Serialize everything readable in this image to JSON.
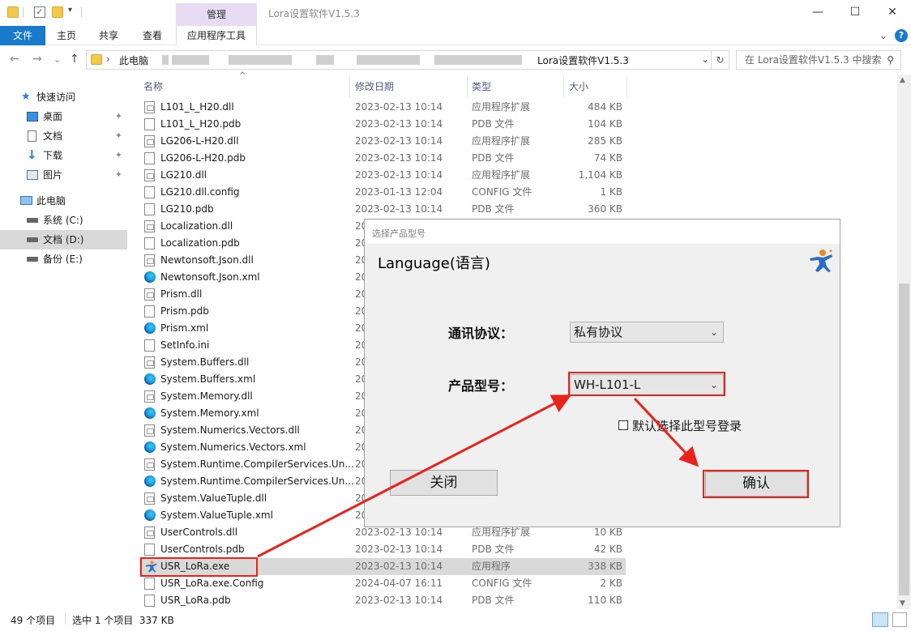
{
  "window": {
    "title": "Lora设置软件V1.5.3",
    "context_tab": "管理",
    "minimize": "—",
    "maximize": "☐",
    "close": "✕"
  },
  "ribbon": {
    "tabs": [
      "文件",
      "主页",
      "共享",
      "查看",
      "应用程序工具"
    ],
    "collapse_glyph": "⌄",
    "help_glyph": "?"
  },
  "address": {
    "back": "←",
    "forward": "→",
    "recent": "⌄",
    "up": "↑",
    "root": "此电脑",
    "current": "Lora设置软件V1.5.3",
    "sep": "›",
    "dropdown": "⌄",
    "refresh": "↻",
    "search_placeholder": "在 Lora设置软件V1.5.3 中搜索",
    "search_icon": "⚲"
  },
  "sidebar": {
    "quick_access": "快速访问",
    "quick_items": [
      {
        "label": "桌面",
        "icon": "desktop-icon"
      },
      {
        "label": "文档",
        "icon": "document-icon"
      },
      {
        "label": "下载",
        "icon": "download-icon"
      },
      {
        "label": "图片",
        "icon": "pictures-icon"
      }
    ],
    "pin_glyph": "📌",
    "this_pc": "此电脑",
    "drives": [
      {
        "label": "系统 (C:)"
      },
      {
        "label": "文档 (D:)"
      },
      {
        "label": "备份 (E:)"
      }
    ]
  },
  "columns": {
    "name": "名称",
    "date": "修改日期",
    "type": "类型",
    "size": "大小",
    "sort_glyph": "^"
  },
  "files": [
    {
      "name": "L101_L_H20.dll",
      "date": "2023-02-13 10:14",
      "type": "应用程序扩展",
      "size": "484 KB",
      "icon": "dll"
    },
    {
      "name": "L101_L_H20.pdb",
      "date": "2023-02-13 10:14",
      "type": "PDB 文件",
      "size": "104 KB",
      "icon": "doc"
    },
    {
      "name": "LG206-L-H20.dll",
      "date": "2023-02-13 10:14",
      "type": "应用程序扩展",
      "size": "285 KB",
      "icon": "dll"
    },
    {
      "name": "LG206-L-H20.pdb",
      "date": "2023-02-13 10:14",
      "type": "PDB 文件",
      "size": "74 KB",
      "icon": "doc"
    },
    {
      "name": "LG210.dll",
      "date": "2023-02-13 10:14",
      "type": "应用程序扩展",
      "size": "1,104 KB",
      "icon": "dll"
    },
    {
      "name": "LG210.dll.config",
      "date": "2023-01-13 12:04",
      "type": "CONFIG 文件",
      "size": "1 KB",
      "icon": "doc"
    },
    {
      "name": "LG210.pdb",
      "date": "2023-02-13 10:14",
      "type": "PDB 文件",
      "size": "360 KB",
      "icon": "doc"
    },
    {
      "name": "Localization.dll",
      "date": "20",
      "type": "",
      "size": "",
      "icon": "dll"
    },
    {
      "name": "Localization.pdb",
      "date": "20",
      "type": "",
      "size": "",
      "icon": "doc"
    },
    {
      "name": "Newtonsoft.Json.dll",
      "date": "20",
      "type": "",
      "size": "",
      "icon": "dll"
    },
    {
      "name": "Newtonsoft.Json.xml",
      "date": "20",
      "type": "",
      "size": "",
      "icon": "edge"
    },
    {
      "name": "Prism.dll",
      "date": "20",
      "type": "",
      "size": "",
      "icon": "dll"
    },
    {
      "name": "Prism.pdb",
      "date": "20",
      "type": "",
      "size": "",
      "icon": "doc"
    },
    {
      "name": "Prism.xml",
      "date": "20",
      "type": "",
      "size": "",
      "icon": "edge"
    },
    {
      "name": "SetInfo.ini",
      "date": "20",
      "type": "",
      "size": "",
      "icon": "doc"
    },
    {
      "name": "System.Buffers.dll",
      "date": "20",
      "type": "",
      "size": "",
      "icon": "dll"
    },
    {
      "name": "System.Buffers.xml",
      "date": "20",
      "type": "",
      "size": "",
      "icon": "edge"
    },
    {
      "name": "System.Memory.dll",
      "date": "20",
      "type": "",
      "size": "",
      "icon": "dll"
    },
    {
      "name": "System.Memory.xml",
      "date": "20",
      "type": "",
      "size": "",
      "icon": "edge"
    },
    {
      "name": "System.Numerics.Vectors.dll",
      "date": "20",
      "type": "",
      "size": "",
      "icon": "dll"
    },
    {
      "name": "System.Numerics.Vectors.xml",
      "date": "20",
      "type": "",
      "size": "",
      "icon": "edge"
    },
    {
      "name": "System.Runtime.CompilerServices.Un...",
      "date": "20",
      "type": "",
      "size": "",
      "icon": "dll"
    },
    {
      "name": "System.Runtime.CompilerServices.Un...",
      "date": "20",
      "type": "",
      "size": "",
      "icon": "edge"
    },
    {
      "name": "System.ValueTuple.dll",
      "date": "20",
      "type": "",
      "size": "",
      "icon": "dll"
    },
    {
      "name": "System.ValueTuple.xml",
      "date": "20",
      "type": "",
      "size": "",
      "icon": "edge"
    },
    {
      "name": "UserControls.dll",
      "date": "2023-02-13 10:14",
      "type": "应用程序扩展",
      "size": "10 KB",
      "icon": "dll"
    },
    {
      "name": "UserControls.pdb",
      "date": "2023-02-13 10:14",
      "type": "PDB 文件",
      "size": "42 KB",
      "icon": "doc"
    },
    {
      "name": "USR_LoRa.exe",
      "date": "2023-02-13 10:14",
      "type": "应用程序",
      "size": "338 KB",
      "icon": "exe",
      "selected": true
    },
    {
      "name": "USR_LoRa.exe.Config",
      "date": "2024-04-07 16:11",
      "type": "CONFIG 文件",
      "size": "2 KB",
      "icon": "doc"
    },
    {
      "name": "USR_LoRa.pdb",
      "date": "2023-02-13 10:14",
      "type": "PDB 文件",
      "size": "110 KB",
      "icon": "doc"
    }
  ],
  "status": {
    "count": "49 个项目",
    "selection": "选中 1 个项目  337 KB"
  },
  "dialog": {
    "title": "选择产品型号",
    "language": "Language(语言)",
    "protocol_label": "通讯协议：",
    "protocol_value": "私有协议",
    "model_label": "产品型号：",
    "model_value": "WH-L101-L",
    "combo_arrow": "⌄",
    "remember_label": "默认选择此型号登录",
    "remember_checked": false,
    "close_button": "关闭",
    "confirm_button": "确认"
  },
  "colors": {
    "accent": "#1979ca",
    "annotation": "#e8231b",
    "manage_tab": "#e8dcf4"
  }
}
